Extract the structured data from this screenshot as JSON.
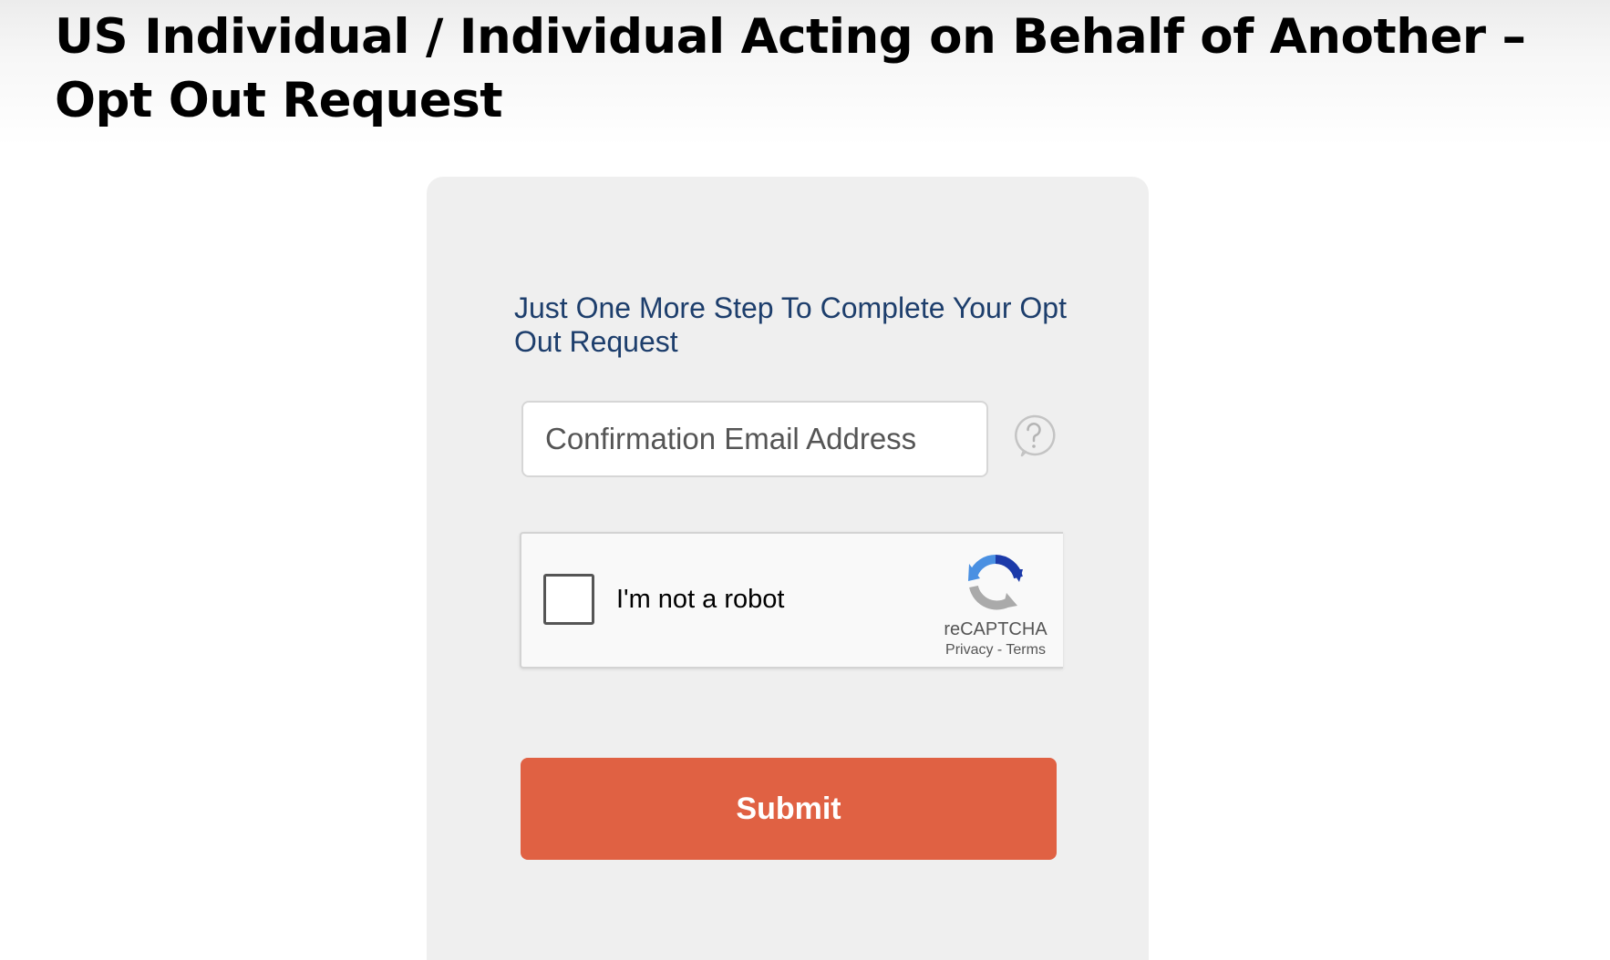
{
  "page": {
    "title": "US Individual / Individual Acting on Behalf of Another – Opt Out Request"
  },
  "form": {
    "heading": "Just One More Step To Complete Your Opt Out Request",
    "email_placeholder": "Confirmation Email Address",
    "help_icon": "question-circle-icon",
    "submit_label": "Submit",
    "submit_color": "#e06143",
    "heading_color": "#1d3e6c"
  },
  "recaptcha": {
    "checkbox_label": "I'm not a robot",
    "checked": false,
    "brand": "reCAPTCHA",
    "privacy_label": "Privacy",
    "separator": "-",
    "terms_label": "Terms",
    "logo_icon": "recaptcha-logo-icon"
  }
}
